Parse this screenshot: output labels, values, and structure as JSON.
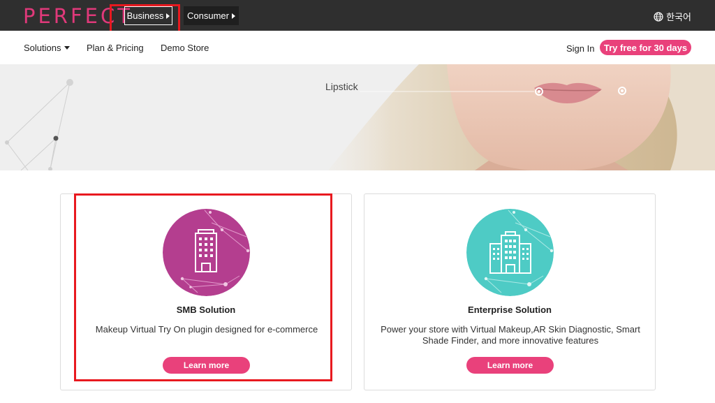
{
  "topbar": {
    "logo": "PERFECT",
    "business_label": "Business",
    "consumer_label": "Consumer",
    "language_label": "한국어"
  },
  "nav": {
    "solutions": "Solutions",
    "plan_pricing": "Plan & Pricing",
    "demo_store": "Demo Store",
    "sign_in": "Sign In",
    "try_free": "Try free for 30 days"
  },
  "hero": {
    "label": "Lipstick"
  },
  "cards": [
    {
      "title": "SMB Solution",
      "description": "Makeup Virtual Try On plugin designed for e-commerce",
      "button": "Learn more",
      "icon": "building-icon",
      "color": "#b43e8f"
    },
    {
      "title": "Enterprise Solution",
      "description": "Power your store with Virtual Makeup,AR Skin Diagnostic, Smart Shade Finder, and more innovative features",
      "button": "Learn more",
      "icon": "buildings-icon",
      "color": "#4ecbc5"
    }
  ],
  "colors": {
    "accent": "#e9417b",
    "topbar": "#2f2f2f",
    "highlight": "#e8191f"
  }
}
